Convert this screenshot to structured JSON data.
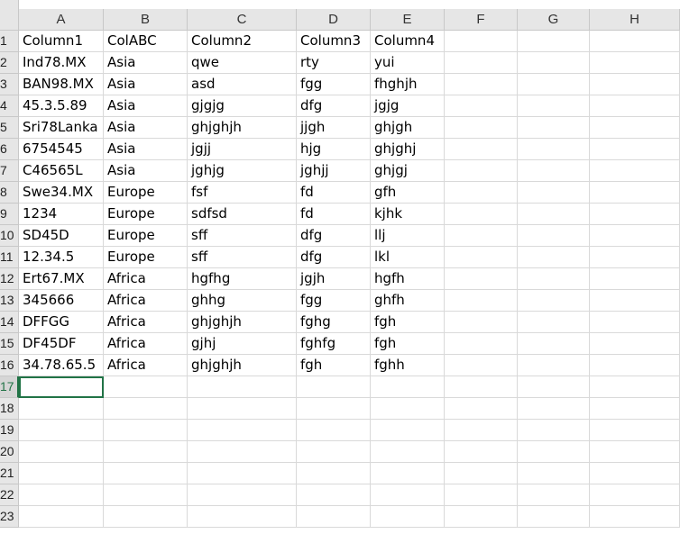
{
  "columns": [
    "A",
    "B",
    "C",
    "D",
    "E",
    "F",
    "G",
    "H"
  ],
  "row_numbers": [
    "1",
    "2",
    "3",
    "4",
    "5",
    "6",
    "7",
    "8",
    "9",
    "10",
    "11",
    "12",
    "13",
    "14",
    "15",
    "16",
    "17",
    "18",
    "19",
    "20",
    "21",
    "22",
    "23"
  ],
  "selected_row": "17",
  "rows": [
    [
      "Column1",
      "ColABC",
      "Column2",
      "Column3",
      "Column4"
    ],
    [
      "Ind78.MX",
      "Asia",
      "qwe",
      "rty",
      "yui"
    ],
    [
      "BAN98.MX",
      "Asia",
      "asd",
      "fgg",
      "fhghjh"
    ],
    [
      "45.3.5.89",
      "Asia",
      "gjgjg",
      "dfg",
      "jgjg"
    ],
    [
      "Sri78Lanka",
      "Asia",
      "ghjghjh",
      "jjgh",
      "ghjgh"
    ],
    [
      "6754545",
      "Asia",
      "jgjj",
      "hjg",
      "ghjghj"
    ],
    [
      "C46565L",
      "Asia",
      "jghjg",
      "jghjj",
      "ghjgj"
    ],
    [
      "Swe34.MX",
      "Europe",
      "fsf",
      "fd",
      "gfh"
    ],
    [
      "1234",
      "Europe",
      "sdfsd",
      "fd",
      "kjhk"
    ],
    [
      "SD45D",
      "Europe",
      "sff",
      "dfg",
      "llj"
    ],
    [
      "12.34.5",
      "Europe",
      "sff",
      "dfg",
      "lkl"
    ],
    [
      "Ert67.MX",
      "Africa",
      "hgfhg",
      "jgjh",
      "hgfh"
    ],
    [
      "345666",
      "Africa",
      "ghhg",
      "fgg",
      "ghfh"
    ],
    [
      "DFFGG",
      "Africa",
      "ghjghjh",
      "fghg",
      "fgh"
    ],
    [
      "DF45DF",
      "Africa",
      "gjhj",
      "fghfg",
      "fgh"
    ],
    [
      "34.78.65.5",
      "Africa",
      "ghjghjh",
      "fgh",
      "fghh"
    ]
  ]
}
